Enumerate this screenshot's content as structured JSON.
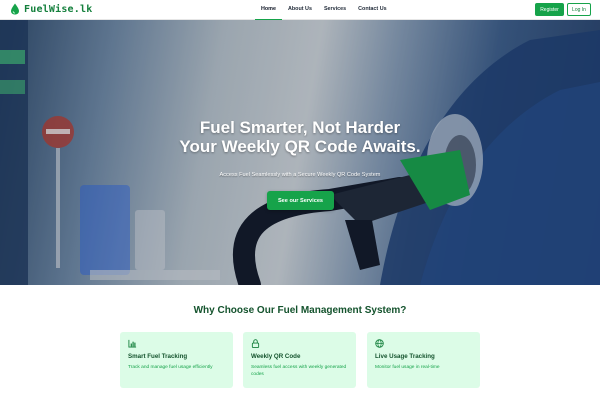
{
  "header": {
    "brand": "FuelWise.lk",
    "nav": [
      {
        "label": "Home",
        "active": true
      },
      {
        "label": "About Us",
        "active": false
      },
      {
        "label": "Services",
        "active": false
      },
      {
        "label": "Contact Us",
        "active": false
      }
    ],
    "register_label": "Register",
    "login_label": "Log In"
  },
  "hero": {
    "title_line1": "Fuel Smarter, Not Harder",
    "title_line2": "Your Weekly QR Code Awaits.",
    "subtitle": "Access Fuel Seamlessly with a Secure Weekly QR Code System",
    "cta_label": "See our Services"
  },
  "features": {
    "heading": "Why Choose Our Fuel Management System?",
    "cards": [
      {
        "icon": "bar-chart-icon",
        "title": "Smart Fuel Tracking",
        "text": "Track and manage fuel usage efficiently"
      },
      {
        "icon": "lock-icon",
        "title": "Weekly QR Code",
        "text": "Seamless fuel access with weekly generated codes"
      },
      {
        "icon": "globe-icon",
        "title": "Live Usage Tracking",
        "text": "Monitor fuel usage in real-time"
      }
    ]
  },
  "colors": {
    "accent": "#16a34a",
    "accent_dark": "#14532d",
    "card_bg": "#dcfce7"
  }
}
